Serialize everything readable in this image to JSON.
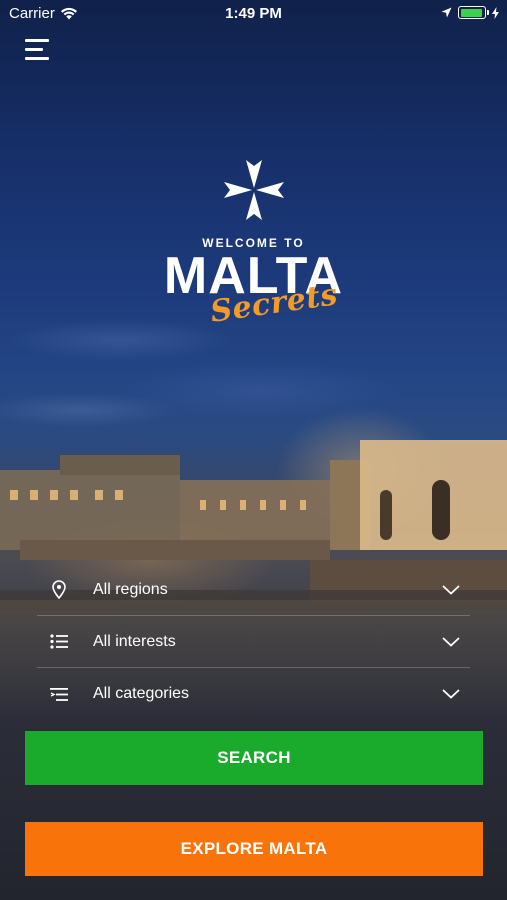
{
  "status_bar": {
    "carrier": "Carrier",
    "time": "1:49 PM",
    "battery_level": 0.95,
    "battery_color": "#3ad34b"
  },
  "header": {
    "menu_icon": "hamburger-menu-icon"
  },
  "logo": {
    "emblem_icon": "maltese-cross-icon",
    "welcome_text": "WELCOME TO",
    "title": "MALTA",
    "subtitle": "Secrets",
    "subtitle_color": "#f39a27"
  },
  "filters": [
    {
      "icon": "location-pin-icon",
      "label": "All regions"
    },
    {
      "icon": "list-icon",
      "label": "All interests"
    },
    {
      "icon": "categories-icon",
      "label": "All categories"
    }
  ],
  "buttons": {
    "search": {
      "label": "SEARCH",
      "color": "#1aaa2c"
    },
    "explore": {
      "label": "EXPLORE MALTA",
      "color": "#f8740a"
    }
  }
}
